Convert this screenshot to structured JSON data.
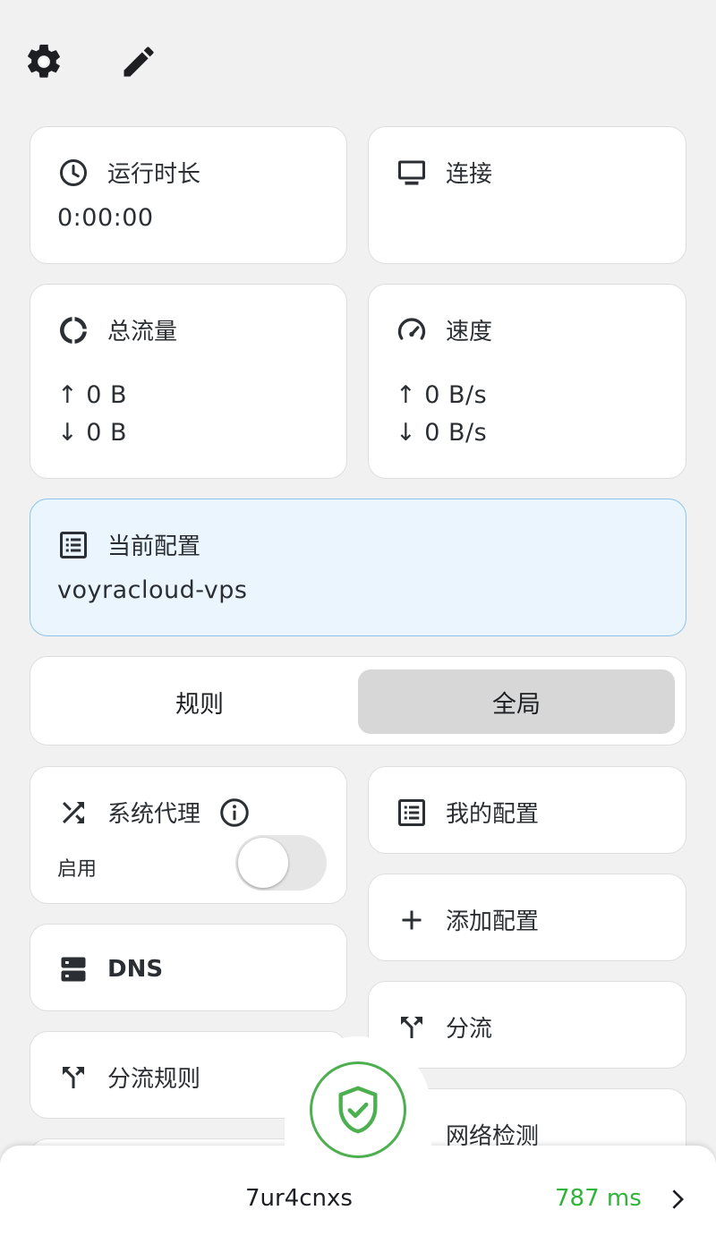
{
  "header": {
    "settings_icon": "gear-icon",
    "edit_icon": "pencil-icon"
  },
  "uptime": {
    "label": "运行时长",
    "value": "0:00:00",
    "icon": "clock-icon"
  },
  "connections": {
    "label": "连接",
    "icon": "monitor-icon"
  },
  "traffic": {
    "label": "总流量",
    "up": "↑ 0 B",
    "down": "↓ 0 B",
    "icon": "donut-chart-icon"
  },
  "speed": {
    "label": "速度",
    "up": "↑ 0 B/s",
    "down": "↓ 0 B/s",
    "icon": "speedometer-icon"
  },
  "current_profile": {
    "label": "当前配置",
    "value": "voyracloud-vps",
    "icon": "list-icon"
  },
  "mode": {
    "rule_label": "规则",
    "global_label": "全局",
    "selected": "global"
  },
  "system_proxy": {
    "label": "系统代理",
    "enable_label": "启用",
    "enabled": false,
    "icon": "shuffle-icon"
  },
  "dns": {
    "label": "DNS",
    "icon": "server-icon"
  },
  "routing_rules": {
    "label": "分流规则",
    "icon": "split-icon"
  },
  "my_profiles": {
    "label": "我的配置",
    "icon": "list-icon"
  },
  "add_profile": {
    "label": "添加配置",
    "icon": "plus-icon"
  },
  "routing": {
    "label": "分流",
    "icon": "split-icon"
  },
  "network_check": {
    "label": "网络检测"
  },
  "footer": {
    "node_name": "7ur4cnxs",
    "latency": "787 ms",
    "latency_color": "#2fb43a",
    "connect_icon": "shield-check-icon"
  },
  "colors": {
    "accent_green": "#4caf50",
    "profile_bg": "#ebf5fd",
    "profile_border": "#8cc4ec"
  }
}
